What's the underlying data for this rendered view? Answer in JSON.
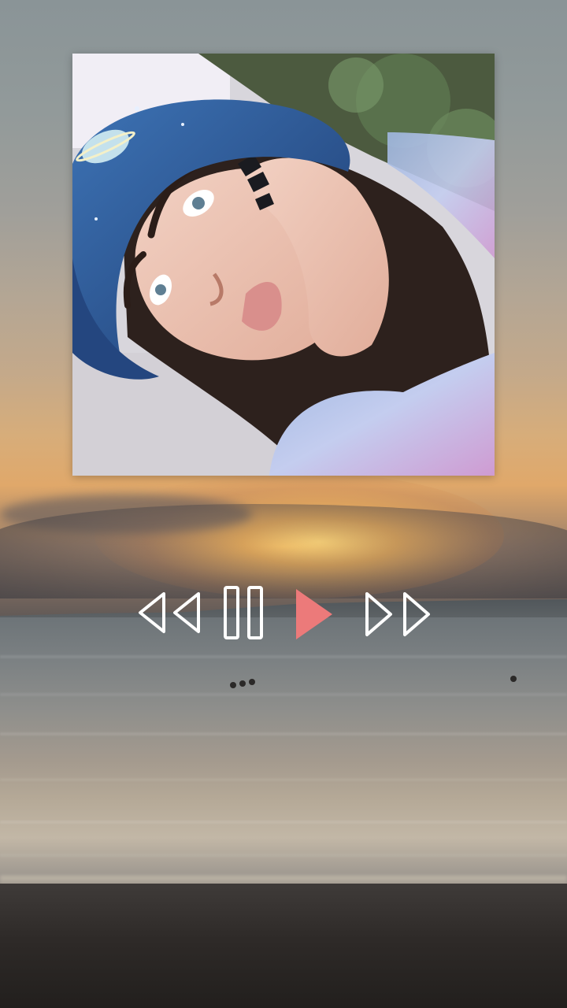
{
  "player": {
    "controls": [
      {
        "name": "rewind",
        "icon": "rewind-icon"
      },
      {
        "name": "pause",
        "icon": "pause-icon"
      },
      {
        "name": "play",
        "icon": "play-icon",
        "accent": "#ec7a7a"
      },
      {
        "name": "fast_forward",
        "icon": "fast-forward-icon"
      }
    ],
    "outline_color": "#ffffff"
  },
  "album_art": {
    "icon": "portrait-photo"
  }
}
